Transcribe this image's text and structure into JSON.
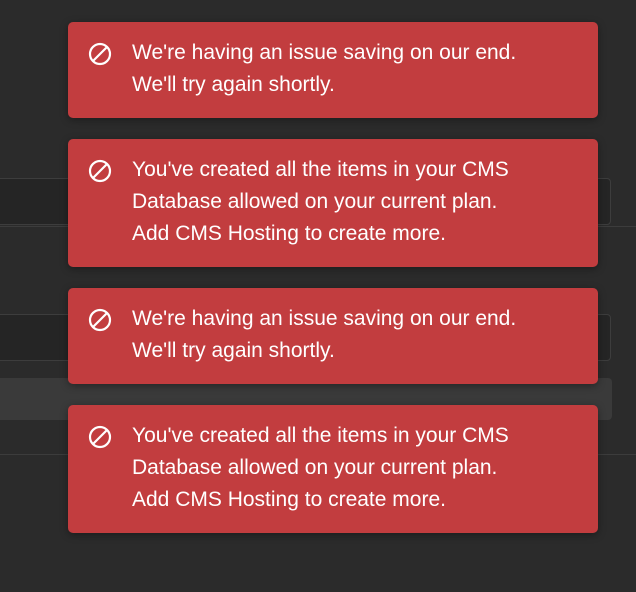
{
  "theme": {
    "background": "#2b2b2b",
    "toast_color": "#c23d3f",
    "text_color": "#ffffff"
  },
  "toasts": [
    {
      "icon": "prohibited-icon",
      "line1": "We're having an issue saving on our end.",
      "line2": "We'll try again shortly."
    },
    {
      "icon": "prohibited-icon",
      "line1": "You've created all the items in your CMS",
      "line2": "Database allowed on your current plan.",
      "line3": "Add CMS Hosting to create more."
    },
    {
      "icon": "prohibited-icon",
      "line1": "We're having an issue saving on our end.",
      "line2": "We'll try again shortly."
    },
    {
      "icon": "prohibited-icon",
      "line1": "You've created all the items in your CMS",
      "line2": "Database allowed on your current plan.",
      "line3": "Add CMS Hosting to create more."
    }
  ]
}
